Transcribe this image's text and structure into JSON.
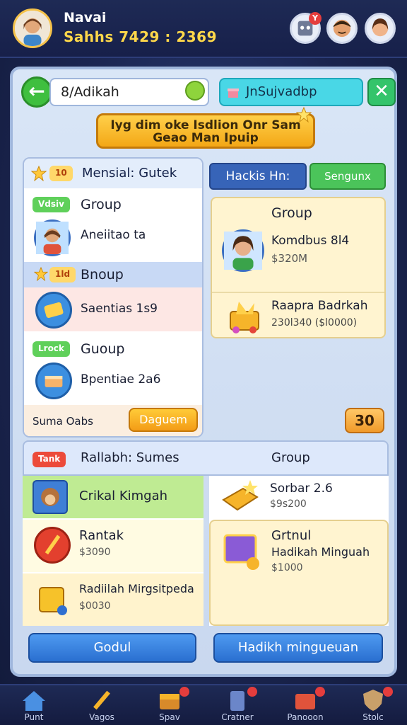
{
  "player": {
    "name": "Navai",
    "stats": "Sahhs 7429 : 2369"
  },
  "header": {
    "search_value": "8/Adikah",
    "tab_label": "JnSujvadbp"
  },
  "banner": {
    "line1": "Iyg dim oke Isdlion Onr Sam",
    "line2": "Geao Man Ipuip"
  },
  "left_panel": {
    "header_badge": "10",
    "header_title": "Mensial: Gutek",
    "rows": [
      {
        "badge": "Vdsiv",
        "title": "Group",
        "subtitle": "Aneiitao ta"
      },
      {
        "badge": "1ld",
        "title": "Bnoup",
        "subtitle": "Saentias 1s9"
      },
      {
        "badge": "Lrock",
        "title": "Guoup",
        "subtitle": "Bpentiae 2a6"
      }
    ],
    "footer_label": "Suma Oabs",
    "footer_button": "Daguem"
  },
  "right_panel": {
    "tab_primary": "Hackis Hn:",
    "tab_secondary": "Sengunx",
    "card": {
      "title": "Group",
      "entry_name": "Komdbus 8l4",
      "entry_value": "$320M",
      "reward_name": "Raapra Badrkah",
      "reward_value": "230l340 ($l0000)"
    },
    "count": "30"
  },
  "lower": {
    "badge": "Tank",
    "title": "Rallabh: Sumes",
    "right_title": "Group",
    "left_items": [
      {
        "title": "Crikal Kimgah",
        "value": ""
      },
      {
        "title": "Rantak",
        "value": "$3090"
      },
      {
        "title": "Radiilah Mirgsitpeda",
        "value": "$0030"
      }
    ],
    "right_items": [
      {
        "title": "Sorbar 2.6",
        "value": "$9s200"
      },
      {
        "title": "Grtnul",
        "subtitle": "Hadikah Minguah",
        "value": "$1000"
      }
    ],
    "button_left": "Godul",
    "button_right": "Hadikh mingueuan"
  },
  "nav": [
    {
      "label": "Punt",
      "icon": "home-icon"
    },
    {
      "label": "Vagos",
      "icon": "sword-icon"
    },
    {
      "label": "Spav",
      "icon": "chest-icon"
    },
    {
      "label": "Cratner",
      "icon": "card-icon"
    },
    {
      "label": "Panooon",
      "icon": "box-icon"
    },
    {
      "label": "Stolc",
      "icon": "shield-icon"
    }
  ],
  "colors": {
    "accent_yellow": "#ffd84a",
    "panel_blue": "#9fb6dc",
    "green": "#3fbf3f",
    "orange": "#f39c16"
  }
}
